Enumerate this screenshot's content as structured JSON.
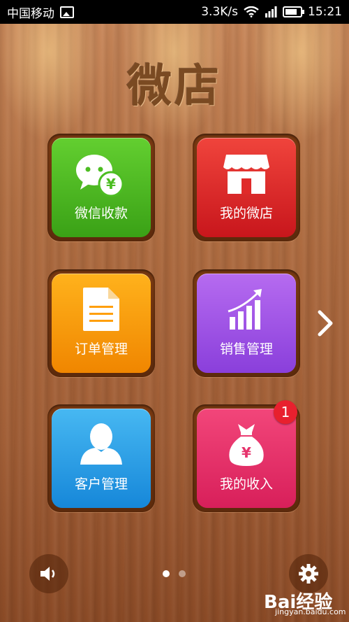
{
  "status_bar": {
    "carrier": "中国移动",
    "speed": "3.3K/s",
    "time": "15:21"
  },
  "app": {
    "title": "微店"
  },
  "tiles": [
    {
      "label": "微信收款",
      "icon": "wechat-payment-icon",
      "color": "#4cbd22"
    },
    {
      "label": "我的微店",
      "icon": "store-icon",
      "color": "#e02a2a"
    },
    {
      "label": "订单管理",
      "icon": "document-icon",
      "color": "#ff9f0a"
    },
    {
      "label": "销售管理",
      "icon": "sales-chart-icon",
      "color": "#a154ea"
    },
    {
      "label": "客户管理",
      "icon": "user-icon",
      "color": "#2aa0e8"
    },
    {
      "label": "我的收入",
      "icon": "money-bag-icon",
      "color": "#e6336c",
      "badge": "1"
    }
  ],
  "pager": {
    "pages": 2,
    "active": 1
  },
  "watermark": {
    "brand": "Bai经验",
    "url": "jingyan.baidu.com"
  }
}
